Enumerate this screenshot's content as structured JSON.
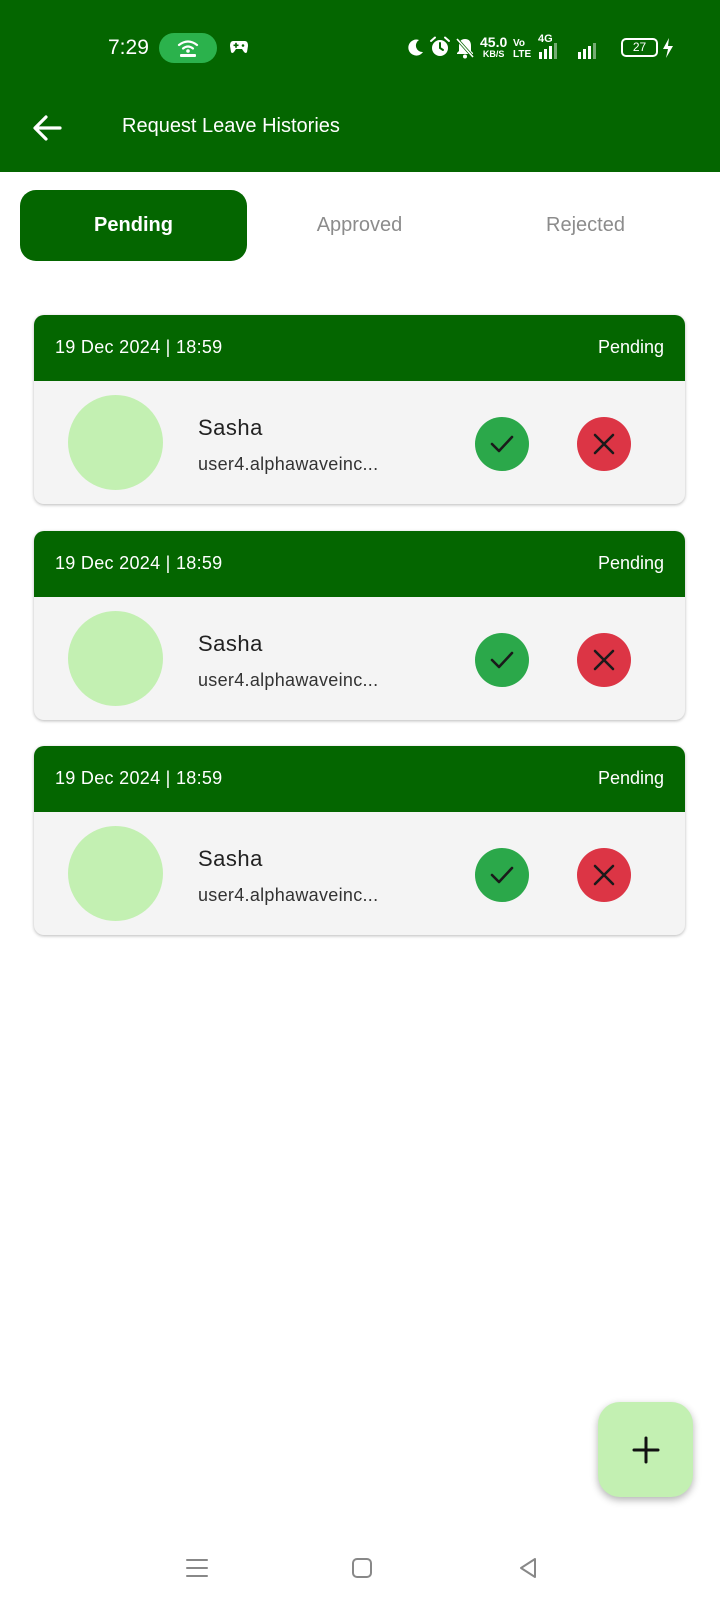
{
  "status_bar": {
    "time": "7:29",
    "net_speed_value": "45.0",
    "net_speed_unit": "KB/S",
    "volte_top": "Vo",
    "volte_bottom": "LTE",
    "network_type": "4G",
    "battery_level": "27",
    "icons": [
      "hotspot-icon",
      "game-controller-icon",
      "moon-icon",
      "alarm-icon",
      "mute-bell-icon",
      "signal-icon",
      "battery-icon",
      "charging-icon"
    ]
  },
  "app_bar": {
    "title": "Request Leave Histories"
  },
  "tabs": [
    {
      "label": "Pending",
      "active": true
    },
    {
      "label": "Approved",
      "active": false
    },
    {
      "label": "Rejected",
      "active": false
    }
  ],
  "requests": [
    {
      "date": "19 Dec 2024 | 18:59",
      "status": "Pending",
      "name": "Sasha",
      "email": "user4.alphawaveinc..."
    },
    {
      "date": "19 Dec 2024 | 18:59",
      "status": "Pending",
      "name": "Sasha",
      "email": "user4.alphawaveinc..."
    },
    {
      "date": "19 Dec 2024 | 18:59",
      "status": "Pending",
      "name": "Sasha",
      "email": "user4.alphawaveinc..."
    }
  ],
  "colors": {
    "primary": "#046600",
    "approve": "#2ba84a",
    "reject": "#dc3545",
    "avatar": "#c3f0b2",
    "fab": "#c3f0b2"
  }
}
